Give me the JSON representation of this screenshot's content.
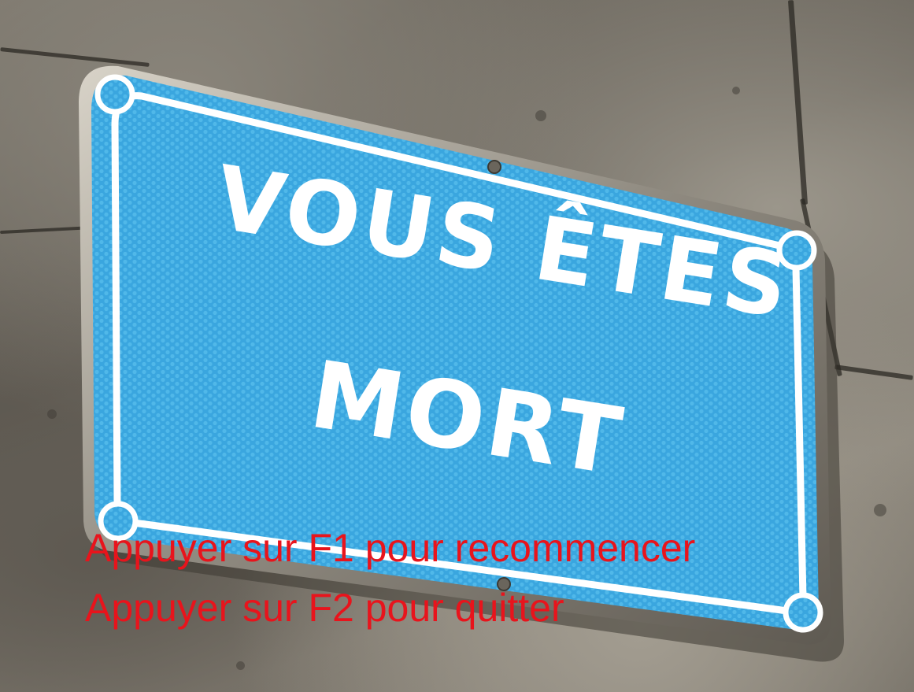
{
  "sign": {
    "line1": "VOUS ÊTES",
    "line2": "MORT"
  },
  "prompts": {
    "restart": "Appuyer sur F1 pour recommencer",
    "quit": "Appuyer sur F2 pour quitter"
  },
  "colors": {
    "sign_blue": "#3aa6df",
    "sign_border": "#ffffff",
    "prompt_text": "#e8141c",
    "wall": "#6e6960"
  }
}
